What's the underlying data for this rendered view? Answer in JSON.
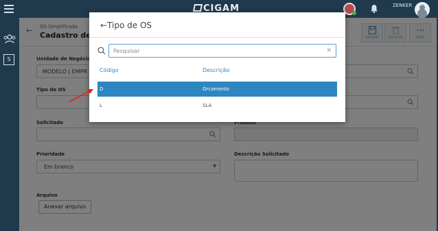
{
  "topbar": {
    "brand": "CIGAM",
    "user": "ZENKER"
  },
  "page": {
    "breadcrumb": "OS Simplificada",
    "title": "Cadastro de O",
    "toolbar": [
      {
        "label": "SALVAR",
        "icon": "save-icon"
      },
      {
        "label": "EXCLUIR",
        "icon": "trash-icon"
      },
      {
        "label": "MAIS",
        "icon": "more-icon"
      }
    ],
    "fields": {
      "unidade": {
        "label": "Unidade de Negócio",
        "value": "MODELO | EMPR"
      },
      "tipo_os": {
        "label": "Tipo de OS",
        "value": ""
      },
      "solicitado": {
        "label": "Solicitado",
        "value": ""
      },
      "produto": {
        "label": "Produto",
        "value": ""
      },
      "prioridade": {
        "label": "Prioridade",
        "value": "Em branco"
      },
      "descricao": {
        "label": "Descrição Solicitado",
        "value": ""
      },
      "arquivo": {
        "label": "Arquivo",
        "button": "Anexar arquivo"
      }
    }
  },
  "modal": {
    "title": "←Tipo de OS",
    "search_placeholder": "Pesquisar",
    "columns": [
      "Código",
      "Descrição"
    ],
    "rows": [
      {
        "code": "D",
        "desc": "Orcamento",
        "selected": true
      },
      {
        "code": "L",
        "desc": "SLA",
        "selected": false
      }
    ]
  },
  "colors": {
    "topbar": "#1f3a4d",
    "accent": "#2e86c1",
    "annotation_arrow": "#e02020"
  }
}
